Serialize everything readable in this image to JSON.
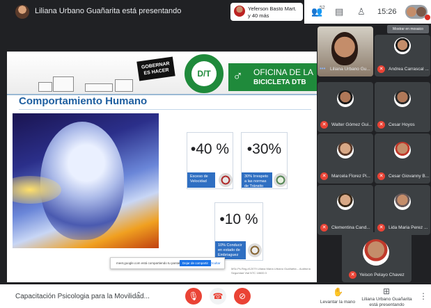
{
  "top": {
    "presenter_text": "Liliana Urbano Guañarita está presentando",
    "notification": {
      "line1": "Yeferson Basto Mart.",
      "line2": "y 40 más"
    },
    "participants_count": "52",
    "clock": "15:26"
  },
  "slide": {
    "banner": {
      "logo_gob": "GOBERNAR ES HACER",
      "dtt_letters": "D/T",
      "oficina_line1": "OFICINA DE LA",
      "oficina_line2": "BICICLETA DTB"
    },
    "title": "Comportamiento Humano",
    "stats": [
      {
        "value": "•40 %",
        "caption": "Exceso de Velocidad"
      },
      {
        "value": "•30%",
        "caption": "30% Irrespeto a las normas de Tránsito"
      },
      {
        "value": "•10 %",
        "caption": "10% Conducir en estado de Embriaguez"
      }
    ],
    "share_bar": {
      "text": "meet.google.com está compartiendo tu pantalla.",
      "stop_label": "Dejar de compartir",
      "hide_label": "Ocultar"
    },
    "credit": "MSc.Ps.Reg.#12079 Liliana María Urbano Guañarita – Auditoría Seguridad Vial NTC 18600:3"
  },
  "participants": {
    "pin_label": "Mostrar en mosaico",
    "tiles": [
      {
        "name": "Liliana Urbano Gu...",
        "active": true
      },
      {
        "name": "Andrea Carrascal ...",
        "muted": true
      },
      {
        "name": "Walter Gómez Gui...",
        "muted": true
      },
      {
        "name": "Cesar Hoyos",
        "muted": true
      },
      {
        "name": "Marcela Florez Pi...",
        "muted": true
      },
      {
        "name": "Cesar Giovanny B...",
        "muted": true
      },
      {
        "name": "Clementina Cand...",
        "muted": true
      },
      {
        "name": "Lida Maria Perez ...",
        "muted": true
      }
    ],
    "featured": {
      "name": "Yeison Pelayo Chavez",
      "muted": true
    }
  },
  "bottom": {
    "meeting_name": "Capacitación Psicologia para la Movilidad...",
    "raise_hand_label": "Levantar la mano",
    "presenting_label_line1": "Liliana Urbano Guañarita",
    "presenting_label_line2": "está presentando"
  },
  "colors": {
    "accent_red": "#ea4335",
    "slide_title_blue": "#1f5fa0",
    "dtt_green": "#1f8a3b",
    "caption_blue": "#2f6fc2"
  }
}
